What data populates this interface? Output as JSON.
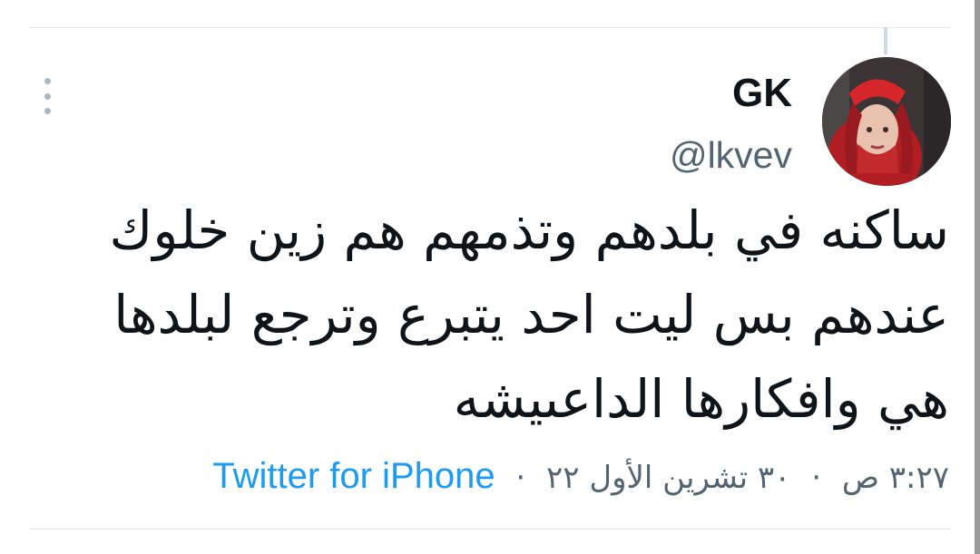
{
  "tweet": {
    "author": {
      "display_name": "GK",
      "handle": "@lkvev",
      "avatar": "profile-photo-avatar"
    },
    "text_lines": [
      "ساكنه في بلدهم وتذمهم هم زين خلوك",
      "عندهم بس ليت احد يتبرع وترجع لبلدها",
      "هي وافكارها الداعىيشه"
    ],
    "meta": {
      "time": "٣:٢٧ ص",
      "separator": "·",
      "date": "٣٠ تشرين الأول ٢٢",
      "source": "Twitter for iPhone"
    },
    "more_menu_icon": "vertical-dots-icon"
  },
  "colors": {
    "text_primary": "#0f1419",
    "text_secondary": "#536471",
    "link_blue": "#1d9bf0",
    "divider": "#e3e6e8"
  }
}
